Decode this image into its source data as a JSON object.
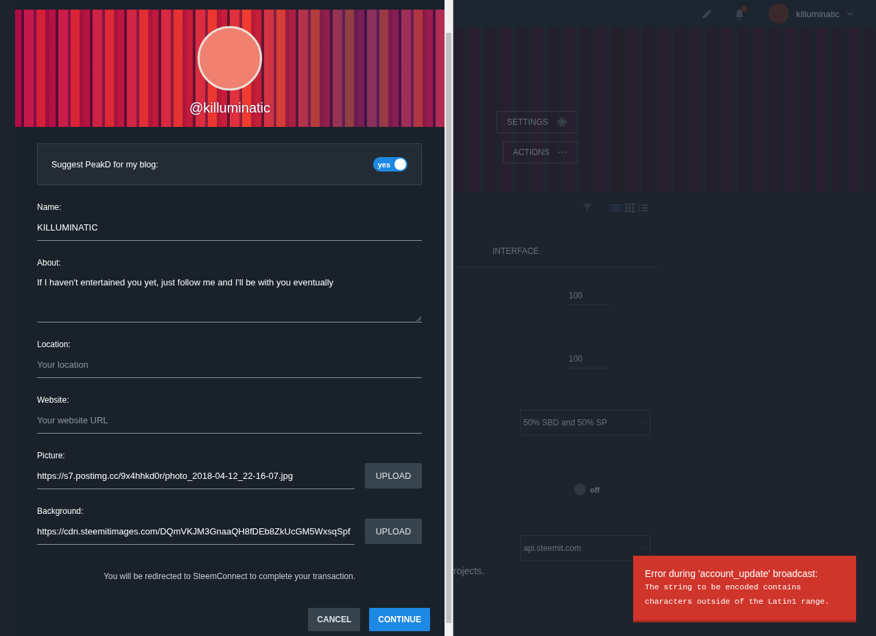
{
  "modal": {
    "banner": {
      "username": "@killuminatic"
    },
    "suggest": {
      "label": "Suggest PeakD for my blog:",
      "on": true,
      "toggle_label": "yes"
    },
    "fields": [
      {
        "kind": "text",
        "label": "Name:",
        "value": "KILLUMINATIC"
      },
      {
        "kind": "textarea",
        "label": "About:",
        "value": "If I haven't entertained you yet, just follow me and I'll be with you eventually"
      },
      {
        "kind": "text",
        "label": "Location:",
        "placeholder": "Your location"
      },
      {
        "kind": "text",
        "label": "Website:",
        "placeholder": "Your website URL"
      },
      {
        "kind": "upload",
        "label": "Picture:",
        "value": "https://s7.postimg.cc/9x4hhkd0r/photo_2018-04-12_22-16-07.jpg",
        "button": "UPLOAD"
      },
      {
        "kind": "upload",
        "label": "Background:",
        "value": "https://cdn.steemitimages.com/DQmVKJM3GnaaQH8fDEb8ZkUcGM5WxsqSpf",
        "button": "UPLOAD"
      }
    ],
    "note": "You will be redirected to SteemConnect to complete your transaction.",
    "buttons": [
      {
        "label": "CANCEL",
        "kind": "secondary"
      },
      {
        "label": "CONTINUE",
        "kind": "primary"
      }
    ]
  },
  "background": {
    "topbar": {
      "username": "killuminatic"
    },
    "buttons": [
      "SETTINGS",
      "ACTIONS"
    ],
    "tab": "INTERFACE",
    "controls": [
      {
        "kind": "input",
        "value": "100"
      },
      {
        "kind": "input",
        "value": "100"
      },
      {
        "kind": "select",
        "value": "50% SBD and 50% SP"
      },
      {
        "kind": "toggle",
        "on": false,
        "label": "off"
      },
      {
        "kind": "select",
        "value": "api.steemit.com"
      }
    ],
    "trailing_text": "rojects."
  },
  "toast": {
    "title": "Error during 'account_update' broadcast:",
    "message": "The string to be encoded contains characters outside of the Latin1 range."
  }
}
